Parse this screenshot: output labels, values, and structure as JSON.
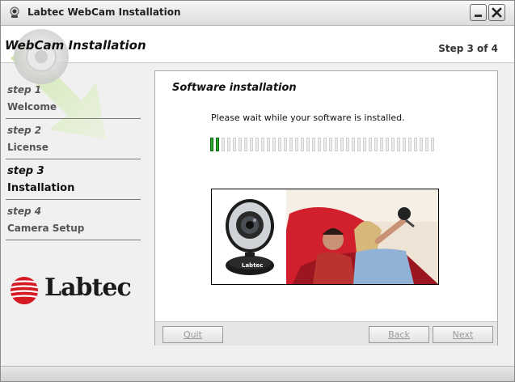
{
  "window": {
    "title": "Labtec WebCam Installation"
  },
  "header": {
    "title": "WebCam Installation",
    "step_indicator": "Step 3 of 4"
  },
  "sidebar": {
    "steps": [
      {
        "number": "step 1",
        "label": "Welcome"
      },
      {
        "number": "step 2",
        "label": "License"
      },
      {
        "number": "step 3",
        "label": "Installation",
        "active": true
      },
      {
        "number": "step 4",
        "label": "Camera Setup"
      }
    ]
  },
  "logo": {
    "text": "Labtec"
  },
  "panel": {
    "title": "Software installation",
    "status": "Please wait while your software is installed.",
    "progress": {
      "filled_segments": 2,
      "total_segments": 40
    },
    "photo_caption_brand": "Labtec"
  },
  "footer": {
    "quit_label": "Quit",
    "back_label": "Back",
    "next_label": "Next"
  },
  "colors": {
    "progress": "#2aa82a",
    "logo_red": "#d41920",
    "accent": "#e8332a"
  }
}
